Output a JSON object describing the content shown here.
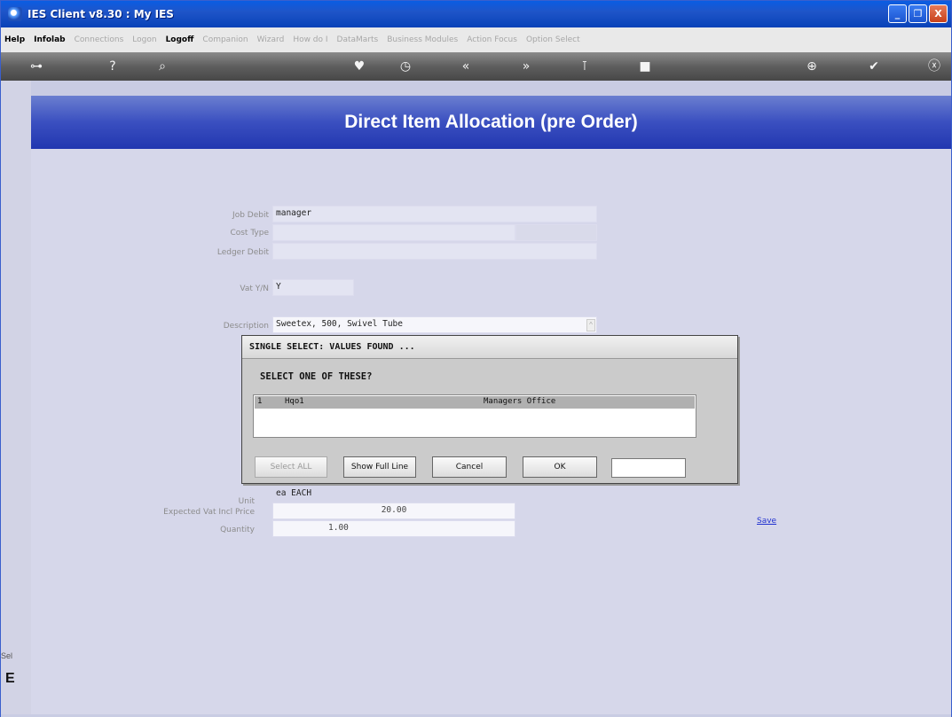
{
  "window": {
    "title": "IES Client v8.30 : My IES",
    "minimize": "_",
    "restore": "❐",
    "close": "X"
  },
  "menu": {
    "items": [
      "Help",
      "Infolab",
      "Connections",
      "Logon",
      "Logoff",
      "Companion",
      "Wizard",
      "How do I",
      "DataMarts",
      "Business Modules",
      "Action Focus",
      "Option Select"
    ]
  },
  "toolbar": {
    "icons": [
      "key-icon",
      "help-icon",
      "search-icon",
      "heart-icon",
      "clock-icon",
      "back-icon",
      "forward-icon",
      "tree-icon",
      "square-icon",
      "plus-icon",
      "check-icon",
      "close-icon"
    ]
  },
  "page": {
    "title": "Direct Item Allocation (pre Order)",
    "side_label": "Sel",
    "side_letter": "E"
  },
  "form": {
    "job_debit_label": "Job Debit",
    "job_debit_value": "manager",
    "cost_type_label": "Cost Type",
    "ledger_debit_label": "Ledger Debit",
    "vat_label": "Vat Y/N",
    "vat_value": "Y",
    "description_label": "Description",
    "description_value": "Sweetex, 500, Swivel Tube",
    "unit_label": "Unit",
    "unit_value": "ea EACH",
    "price_label": "Expected Vat Incl Price",
    "price_value": "20.00",
    "quantity_label": "Quantity",
    "quantity_value": "1.00",
    "save_label": "Save"
  },
  "dialog": {
    "title": "SINGLE SELECT: VALUES FOUND ...",
    "prompt": "SELECT ONE OF THESE?",
    "rows": [
      {
        "num": "1",
        "code": "Hqo1",
        "desc": "Managers Office"
      }
    ],
    "buttons": {
      "select_all": "Select ALL",
      "show_full_line": "Show Full Line",
      "cancel": "Cancel",
      "ok": "OK"
    }
  },
  "colors": {
    "banner": "#3a4fc0",
    "titlebar": "#0a5de3",
    "content_bg": "#d6d7ea"
  }
}
